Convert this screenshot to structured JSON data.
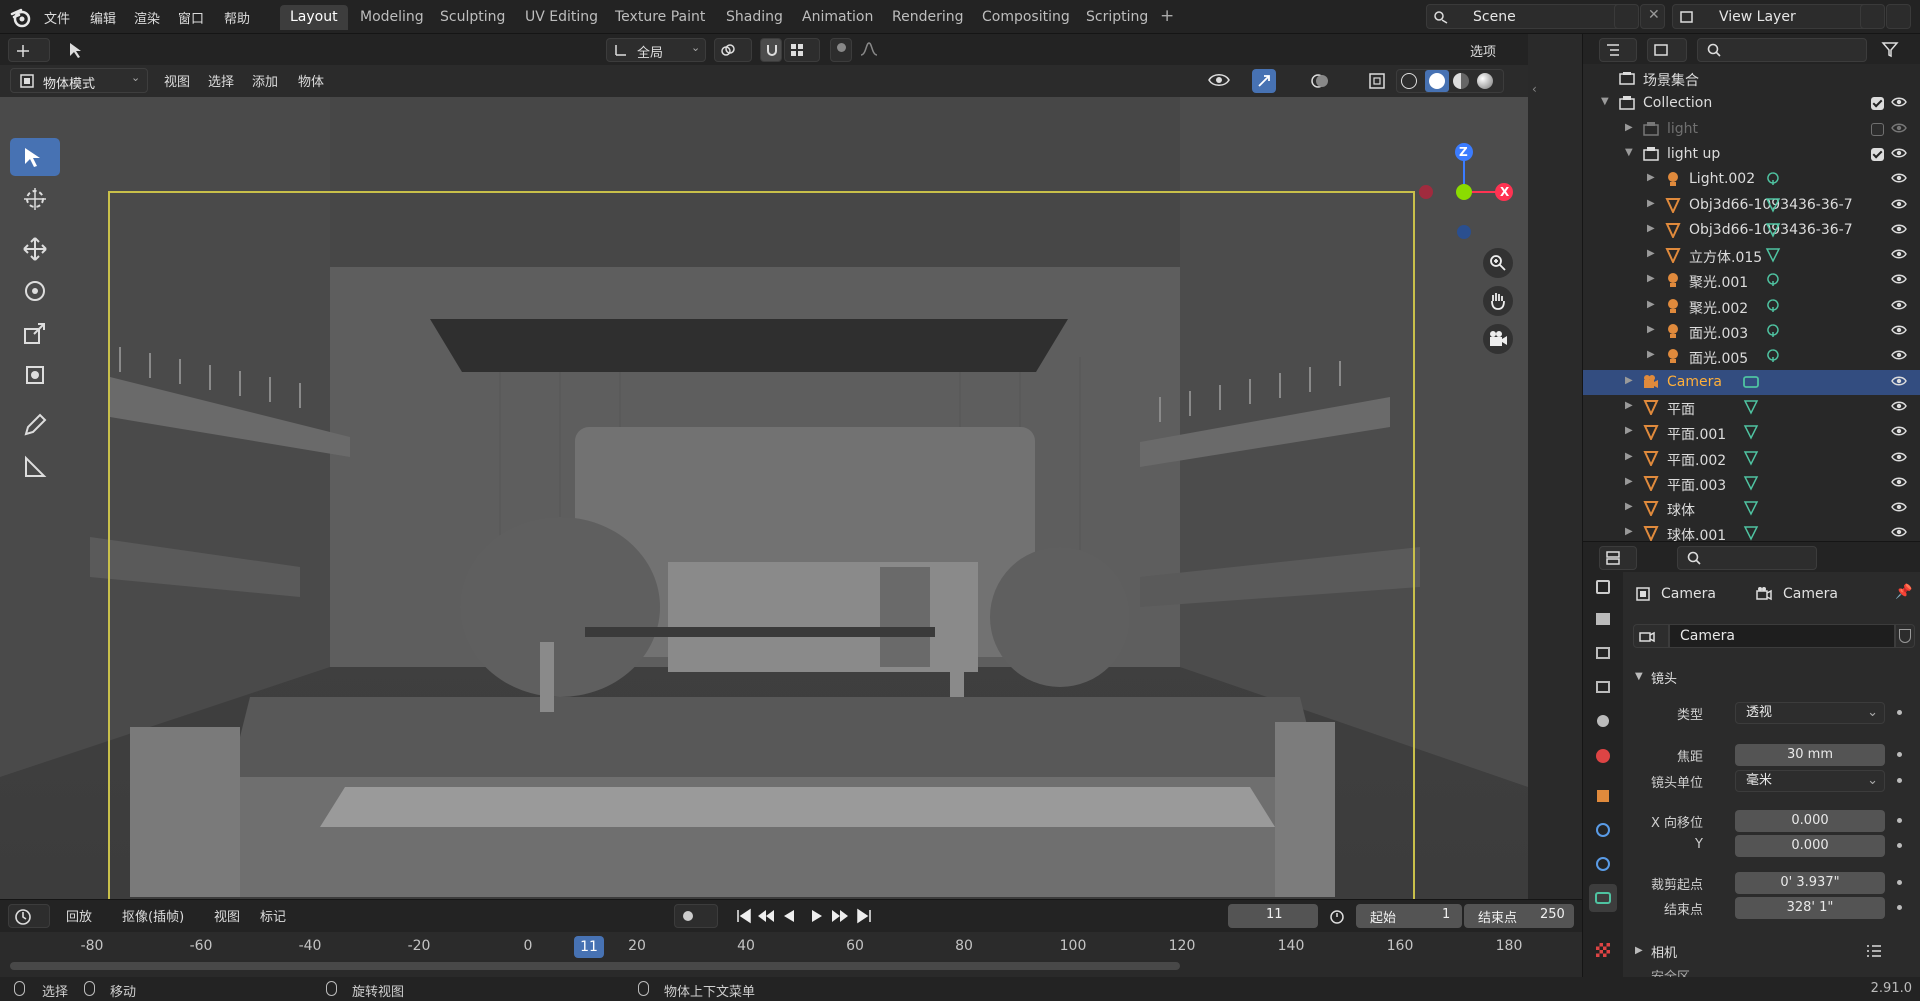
{
  "menu": [
    "文件",
    "编辑",
    "渲染",
    "窗口",
    "帮助"
  ],
  "workspaces": [
    {
      "label": "Layout",
      "active": true
    },
    {
      "label": "Modeling"
    },
    {
      "label": "Sculpting"
    },
    {
      "label": "UV Editing"
    },
    {
      "label": "Texture Paint"
    },
    {
      "label": "Shading"
    },
    {
      "label": "Animation"
    },
    {
      "label": "Rendering"
    },
    {
      "label": "Compositing"
    },
    {
      "label": "Scripting"
    }
  ],
  "scene": {
    "name": "Scene",
    "view_layer": "View Layer"
  },
  "viewport": {
    "transform_orientation": "全局",
    "options_label": "选项",
    "mode": "物体模式",
    "menus": [
      "视图",
      "选择",
      "添加",
      "物体"
    ],
    "gizmo_axes": {
      "z": "Z",
      "x": "X"
    }
  },
  "timeline": {
    "playback_label": "回放",
    "keying_label": "抠像(插帧)",
    "view_label": "视图",
    "marker_label": "标记",
    "current_frame": "11",
    "start_label": "起始",
    "start": "1",
    "end_label": "结束点",
    "end": "250",
    "ticks": [
      "-80",
      "-60",
      "-40",
      "-20",
      "0",
      "20",
      "40",
      "60",
      "80",
      "100",
      "120",
      "140",
      "160",
      "180"
    ]
  },
  "statusbar": {
    "select": "选择",
    "move": "移动",
    "rotate_view": "旋转视图",
    "context_menu": "物体上下文菜单",
    "version": "2.91.0"
  },
  "outliner": {
    "root": "场景集合",
    "rows": [
      {
        "name": "Collection",
        "level": 1,
        "type": "collection",
        "checked": true
      },
      {
        "name": "light",
        "level": 2,
        "type": "collection",
        "checked": false,
        "disabled": true
      },
      {
        "name": "light up",
        "level": 2,
        "type": "collection",
        "checked": true
      },
      {
        "name": "Light.002",
        "level": 3,
        "type": "light"
      },
      {
        "name": "Obj3d66-1093436-36-7",
        "level": 3,
        "type": "mesh"
      },
      {
        "name": "Obj3d66-1093436-36-7",
        "level": 3,
        "type": "mesh"
      },
      {
        "name": "立方体.015",
        "level": 3,
        "type": "mesh"
      },
      {
        "name": "聚光.001",
        "level": 3,
        "type": "light"
      },
      {
        "name": "聚光.002",
        "level": 3,
        "type": "light"
      },
      {
        "name": "面光.003",
        "level": 3,
        "type": "light"
      },
      {
        "name": "面光.005",
        "level": 3,
        "type": "light"
      },
      {
        "name": "Camera",
        "level": 2,
        "type": "camera",
        "selected": true
      },
      {
        "name": "平面",
        "level": 2,
        "type": "mesh"
      },
      {
        "name": "平面.001",
        "level": 2,
        "type": "mesh"
      },
      {
        "name": "平面.002",
        "level": 2,
        "type": "mesh"
      },
      {
        "name": "平面.003",
        "level": 2,
        "type": "mesh"
      },
      {
        "name": "球体",
        "level": 2,
        "type": "mesh"
      },
      {
        "name": "球体.001",
        "level": 2,
        "type": "mesh"
      }
    ]
  },
  "properties": {
    "breadcrumb_object": "Camera",
    "breadcrumb_data": "Camera",
    "datablock_name": "Camera",
    "lens_section": "镜头",
    "type_label": "类型",
    "type_value": "透视",
    "focal_label": "焦距",
    "focal_value": "30 mm",
    "lens_unit_label": "镜头单位",
    "lens_unit_value": "毫米",
    "shift_x_label": "X 向移位",
    "shift_x_value": "0.000",
    "shift_y_label": "Y",
    "shift_y_value": "0.000",
    "clip_start_label": "裁剪起点",
    "clip_start_value": "0' 3.937\"",
    "clip_end_label": "结束点",
    "clip_end_value": "328' 1\"",
    "camera_section": "相机",
    "safe_area_section": "安全区"
  },
  "colors": {
    "accent": "#4772b3",
    "selected_row": "#334d80",
    "mesh_icon": "#e08a3c",
    "data_icon": "#4fc3a1",
    "camera_frame": "#c9c04a"
  }
}
